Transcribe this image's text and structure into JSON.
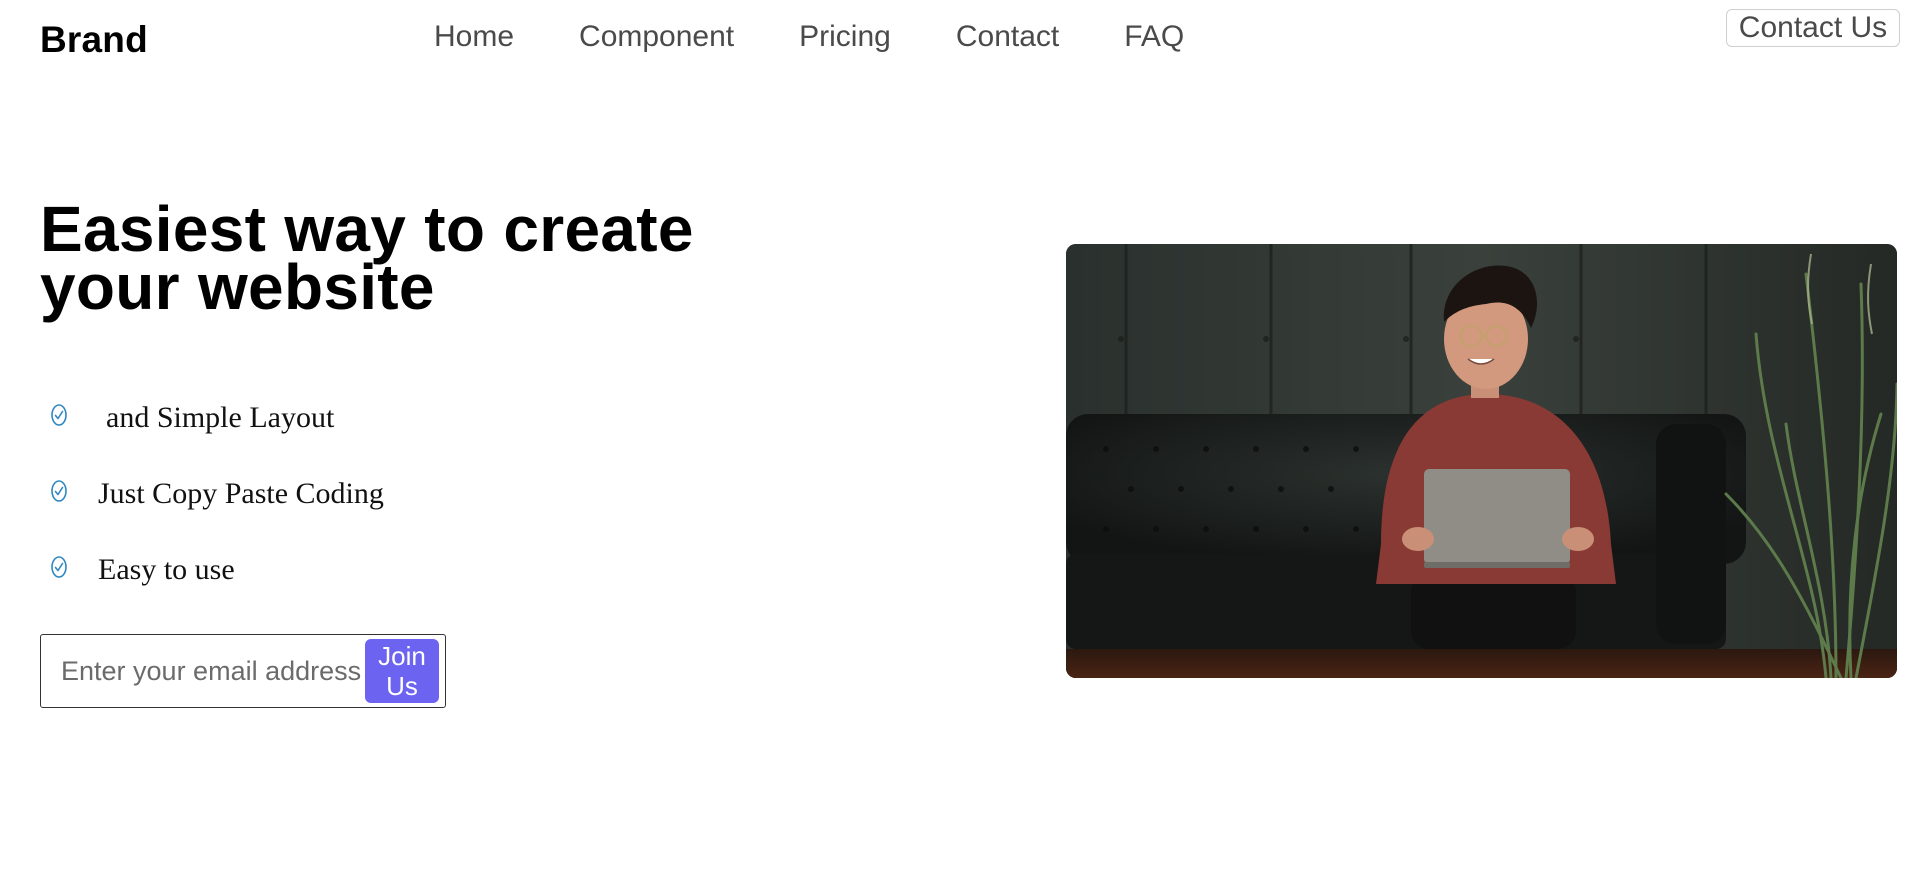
{
  "header": {
    "brand": "Brand",
    "nav": [
      "Home",
      "Component",
      "Pricing",
      "Contact",
      "FAQ"
    ],
    "cta_label": "Contact Us"
  },
  "hero": {
    "title": "Easiest way to create your website",
    "features": [
      {
        "text": "and Simple Layout",
        "icon": "check-circle-icon"
      },
      {
        "text": "Just Copy Paste Coding",
        "icon": "check-circle-icon"
      },
      {
        "text": "Easy to use",
        "icon": "check-circle-icon"
      }
    ],
    "signup": {
      "placeholder": "Enter your email address",
      "button_label": "Join Us"
    },
    "image_icon": "hero-photo"
  },
  "colors": {
    "accent": "#6c63f0",
    "check_icon": "#2e86c1",
    "nav_text": "#4a4a4a"
  }
}
